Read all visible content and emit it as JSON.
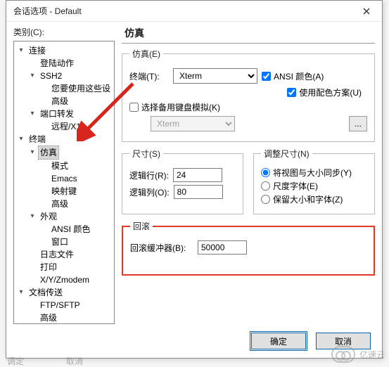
{
  "window": {
    "title": "会话选项 - Default"
  },
  "category_label": "类别(C):",
  "tree": {
    "connection": "连接",
    "login_actions": "登陆动作",
    "ssh2": "SSH2",
    "ssh2_hint": "您要使用这些设",
    "advanced": "高级",
    "port_fwd": "端口转发",
    "remote_x11": "远程/X11",
    "terminal": "终端",
    "emulation": "仿真",
    "mode": "模式",
    "emacs": "Emacs",
    "map_keys": "映射键",
    "appearance": "外观",
    "ansi_color": "ANSI 颜色",
    "window": "窗口",
    "log_file": "日志文件",
    "print": "打印",
    "xyz": "X/Y/Zmodem",
    "file_xfer": "文档传送",
    "ftp": "FTP/SFTP"
  },
  "panel_title": "仿真",
  "emul": {
    "legend": "仿真(E)",
    "terminal_label": "终端(T):",
    "terminal_value": "Xterm",
    "ansi_color": "ANSI 颜色(A)",
    "use_scheme": "使用配色方案(U)",
    "alt_kb": "选择备用键盘模拟(K)",
    "alt_kb_value": "Xterm"
  },
  "size": {
    "legend": "尺寸(S)",
    "rows_label": "逻辑行(R):",
    "rows_value": "24",
    "cols_label": "逻辑列(O):",
    "cols_value": "80"
  },
  "resize": {
    "legend": "调整尺寸(N)",
    "r1": "将视图与大小同步(Y)",
    "r2": "尺度字体(E)",
    "r3": "保留大小和字体(Z)"
  },
  "scroll": {
    "legend": "回滚",
    "buf_label": "回滚缓冲器(B):",
    "buf_value": "50000"
  },
  "buttons": {
    "ok": "确定",
    "cancel": "取消"
  },
  "watermark": "亿速云",
  "frag": {
    "a": "调定",
    "b": "取消"
  }
}
